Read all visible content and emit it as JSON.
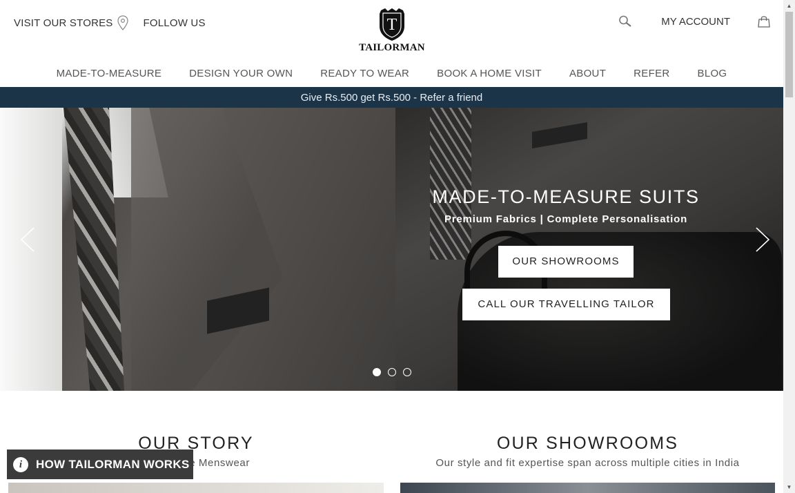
{
  "header": {
    "visit_stores": "VISIT OUR STORES",
    "follow_us": "FOLLOW US",
    "logo_letter": "T",
    "logo_text": "TAILORMAN",
    "my_account": "MY ACCOUNT"
  },
  "nav": {
    "items": [
      {
        "label": "MADE-TO-MEASURE"
      },
      {
        "label": "DESIGN YOUR OWN"
      },
      {
        "label": "READY TO WEAR"
      },
      {
        "label": "BOOK A HOME VISIT"
      },
      {
        "label": "ABOUT"
      },
      {
        "label": "REFER"
      },
      {
        "label": "BLOG"
      }
    ]
  },
  "promo": {
    "text": "Give Rs.500 get Rs.500 - Refer a friend",
    "bg_color": "#1c3447"
  },
  "hero": {
    "title": "MADE-TO-MEASURE SUITS",
    "subtitle": "Premium Fabrics | Complete Personalisation",
    "btn_showrooms": "OUR SHOWROOMS",
    "btn_tailor": "CALL OUR TRAVELLING TAILOR",
    "slides_count": 3,
    "active_slide": 1
  },
  "sections": {
    "story_title": "OUR STORY",
    "story_sub": "o-Measure Menswear",
    "showrooms_title": "OUR SHOWROOMS",
    "showrooms_sub": "Our style and fit expertise span across multiple cities in India"
  },
  "widget": {
    "info_glyph": "i",
    "label": "HOW TAILORMAN WORKS"
  },
  "icons": {
    "pin": "map-pin-icon",
    "search": "search-icon",
    "bag": "shopping-bag-icon",
    "prev": "chevron-left-icon",
    "next": "chevron-right-icon",
    "info": "info-icon"
  }
}
